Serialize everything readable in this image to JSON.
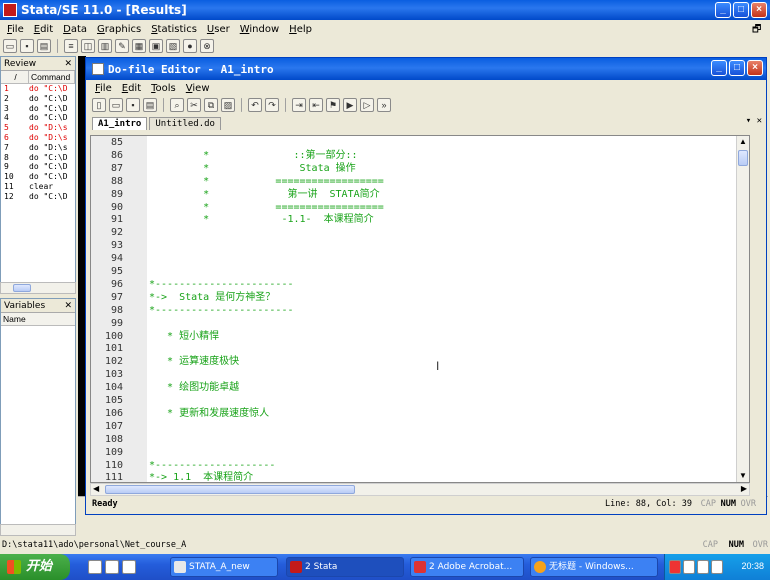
{
  "window": {
    "title": "Stata/SE 11.0 - [Results]"
  },
  "menu": [
    "File",
    "Edit",
    "Data",
    "Graphics",
    "Statistics",
    "User",
    "Window",
    "Help"
  ],
  "review": {
    "title": "Review",
    "col_num": "/",
    "col_cmd": "Command",
    "rows": [
      {
        "n": "1",
        "cmd": "do \"C:\\D",
        "red": true
      },
      {
        "n": "2",
        "cmd": "do \"C:\\D",
        "red": false
      },
      {
        "n": "3",
        "cmd": "do \"C:\\D",
        "red": false
      },
      {
        "n": "4",
        "cmd": "do \"C:\\D",
        "red": false
      },
      {
        "n": "5",
        "cmd": "do \"D:\\s",
        "red": true
      },
      {
        "n": "6",
        "cmd": "do \"D:\\s",
        "red": true
      },
      {
        "n": "7",
        "cmd": "do \"D:\\s",
        "red": false
      },
      {
        "n": "8",
        "cmd": "do \"C:\\D",
        "red": false
      },
      {
        "n": "9",
        "cmd": "do \"C:\\D",
        "red": false
      },
      {
        "n": "10",
        "cmd": "do \"C:\\D",
        "red": false
      },
      {
        "n": "11",
        "cmd": "clear",
        "red": false
      },
      {
        "n": "12",
        "cmd": "do \"C:\\D",
        "red": false
      }
    ]
  },
  "variables": {
    "title": "Variables",
    "col_name": "Name"
  },
  "editor": {
    "title": "Do-file Editor - A1_intro",
    "menu": [
      "File",
      "Edit",
      "Tools",
      "View"
    ],
    "tabs": [
      "A1_intro",
      "Untitled.do"
    ],
    "lines": [
      {
        "n": "85",
        "t": ""
      },
      {
        "n": "86",
        "t": "         *              ::第一部分::"
      },
      {
        "n": "87",
        "t": "         *               Stata 操作"
      },
      {
        "n": "88",
        "t": "         *           =================="
      },
      {
        "n": "89",
        "t": "         *             第一讲  STATA简介"
      },
      {
        "n": "90",
        "t": "         *           =================="
      },
      {
        "n": "91",
        "t": "         *            -1.1-  本课程简介"
      },
      {
        "n": "92",
        "t": ""
      },
      {
        "n": "93",
        "t": ""
      },
      {
        "n": "94",
        "t": ""
      },
      {
        "n": "95",
        "t": ""
      },
      {
        "n": "96",
        "t": "*-----------------------"
      },
      {
        "n": "97",
        "t": "*->  Stata 是何方神圣？"
      },
      {
        "n": "98",
        "t": "*-----------------------"
      },
      {
        "n": "99",
        "t": ""
      },
      {
        "n": "100",
        "t": "   * 短小精悍"
      },
      {
        "n": "101",
        "t": ""
      },
      {
        "n": "102",
        "t": "   * 运算速度极快"
      },
      {
        "n": "103",
        "t": ""
      },
      {
        "n": "104",
        "t": "   * 绘图功能卓越"
      },
      {
        "n": "105",
        "t": ""
      },
      {
        "n": "106",
        "t": "   * 更新和发展速度惊人"
      },
      {
        "n": "107",
        "t": ""
      },
      {
        "n": "108",
        "t": ""
      },
      {
        "n": "109",
        "t": ""
      },
      {
        "n": "110",
        "t": "*--------------------"
      },
      {
        "n": "111",
        "t": "*-> 1.1  本课程简介"
      }
    ],
    "status_left": "Ready",
    "status_right": "Line: 88, Col: 39",
    "indicators": [
      "CAP",
      "NUM",
      "OVR"
    ]
  },
  "path": "D:\\stata11\\ado\\personal\\Net_course_A",
  "path_indicators": [
    "CAP",
    "NUM",
    "OVR"
  ],
  "taskbar": {
    "start": "开始",
    "tasks": [
      "STATA_A_new",
      "2 Stata",
      "2 Adobe Acrobat...",
      "无标题 - Windows..."
    ],
    "clock": "20:38"
  }
}
